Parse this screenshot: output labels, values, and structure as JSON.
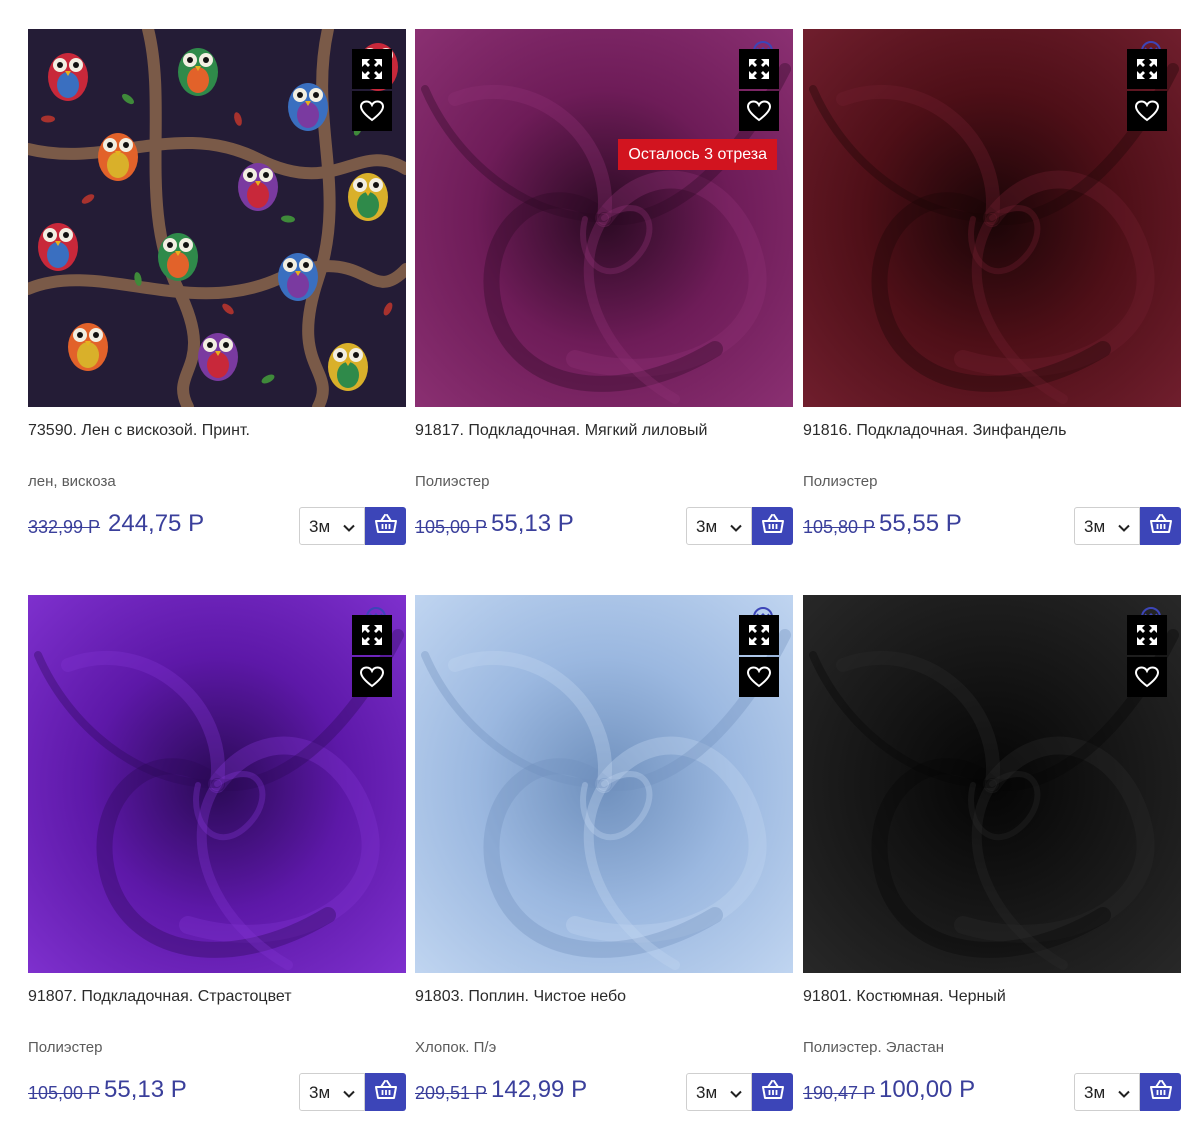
{
  "colors": {
    "price": "#3a3f9b",
    "cart_button": "#3c45b8",
    "badge": "#d2141f"
  },
  "products": [
    {
      "title": "73590. Лен с вискозой. Принт.",
      "material": "лен, вискоза",
      "old_price": "332,99 Р",
      "new_price": "244,75 Р",
      "length": "3м",
      "badge": "",
      "fabric": "owls",
      "colors": [
        "#241c36",
        "#2a2040",
        "#3a2a52"
      ]
    },
    {
      "title": "91817. Подкладочная. Мягкий лиловый",
      "material": "Полиэстер",
      "old_price": "105,00 Р",
      "new_price": "55,13 Р",
      "length": "3м",
      "badge": "Осталось 3 отреза",
      "fabric": "satin",
      "colors": [
        "#2a0a22",
        "#6e1c58",
        "#8e3275"
      ]
    },
    {
      "title": "91816. Подкладочная. Зинфандель",
      "material": "Полиэстер",
      "old_price": "105,80 Р",
      "new_price": "55,55 Р",
      "length": "3м",
      "badge": "",
      "fabric": "satin",
      "colors": [
        "#1a0507",
        "#4e0f17",
        "#742030"
      ]
    },
    {
      "title": "91807. Подкладочная. Страстоцвет",
      "material": "Полиэстер",
      "old_price": "105,00 Р",
      "new_price": "55,13 Р",
      "length": "3м",
      "badge": "",
      "fabric": "satin",
      "colors": [
        "#2a0a55",
        "#5d18a8",
        "#8233d2"
      ]
    },
    {
      "title": "91803. Поплин. Чистое небо",
      "material": "Хлопок. П/э",
      "old_price": "209,51 Р",
      "new_price": "142,99 Р",
      "length": "3м",
      "badge": "",
      "fabric": "satin",
      "colors": [
        "#6f90bd",
        "#9bb8e0",
        "#c4d8f2"
      ]
    },
    {
      "title": "91801. Костюмная. Черный",
      "material": "Полиэстер. Эластан",
      "old_price": "190,47 Р",
      "new_price": "100,00 Р",
      "length": "3м",
      "badge": "",
      "fabric": "satin",
      "colors": [
        "#050505",
        "#161616",
        "#2a2a2a"
      ]
    }
  ]
}
